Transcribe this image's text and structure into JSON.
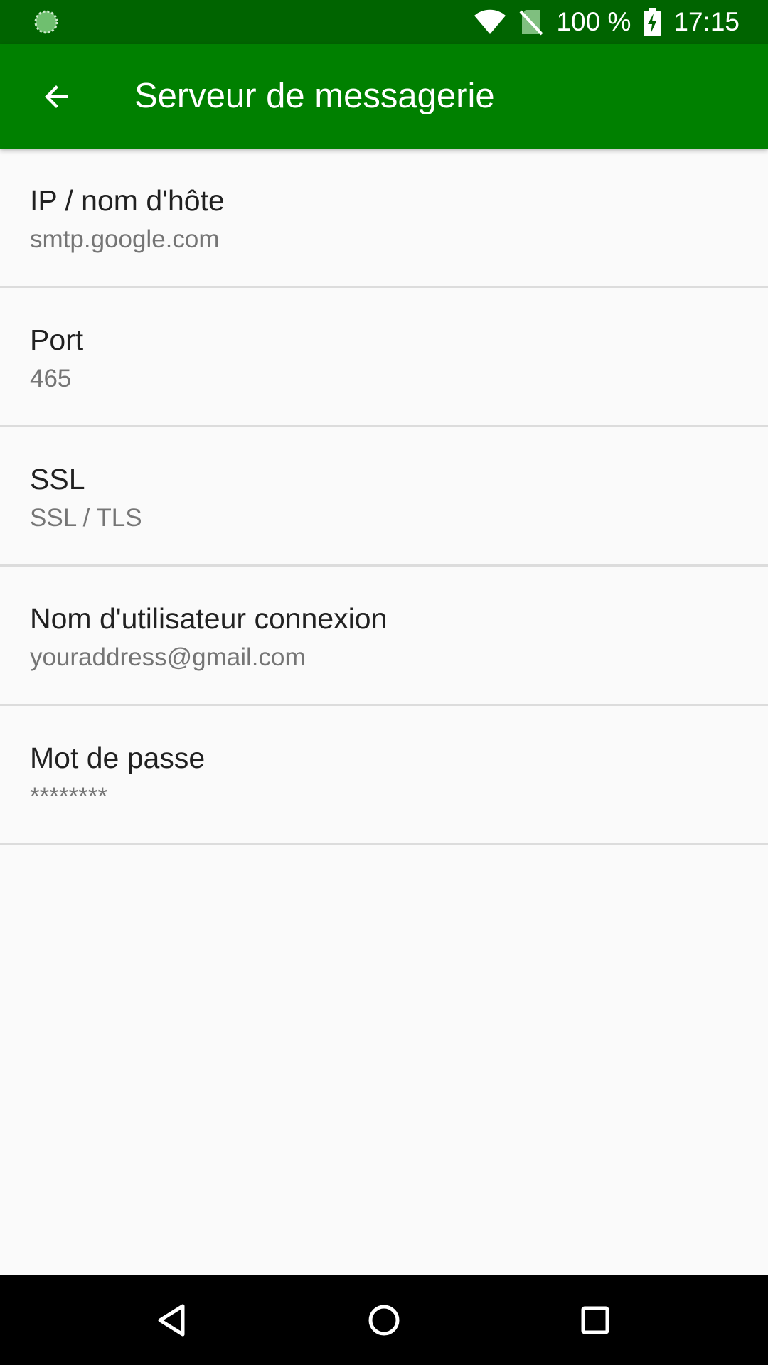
{
  "status_bar": {
    "battery_text": "100 %",
    "time": "17:15",
    "icons": [
      "loading-spinner-icon",
      "wifi-icon",
      "no-sim-icon",
      "battery-charging-icon"
    ]
  },
  "app_bar": {
    "title": "Serveur de messagerie",
    "back_icon": "arrow-back-icon",
    "color": "#008000",
    "status_color": "#006400"
  },
  "preferences": [
    {
      "title": "IP / nom d'hôte",
      "summary": "smtp.google.com"
    },
    {
      "title": "Port",
      "summary": "465"
    },
    {
      "title": "SSL",
      "summary": "SSL / TLS"
    },
    {
      "title": "Nom d'utilisateur connexion",
      "summary": "youraddress@gmail.com"
    },
    {
      "title": "Mot de passe",
      "summary": "********"
    }
  ],
  "nav_bar": {
    "icons": [
      "back-triangle-icon",
      "home-circle-icon",
      "recents-square-icon"
    ]
  }
}
